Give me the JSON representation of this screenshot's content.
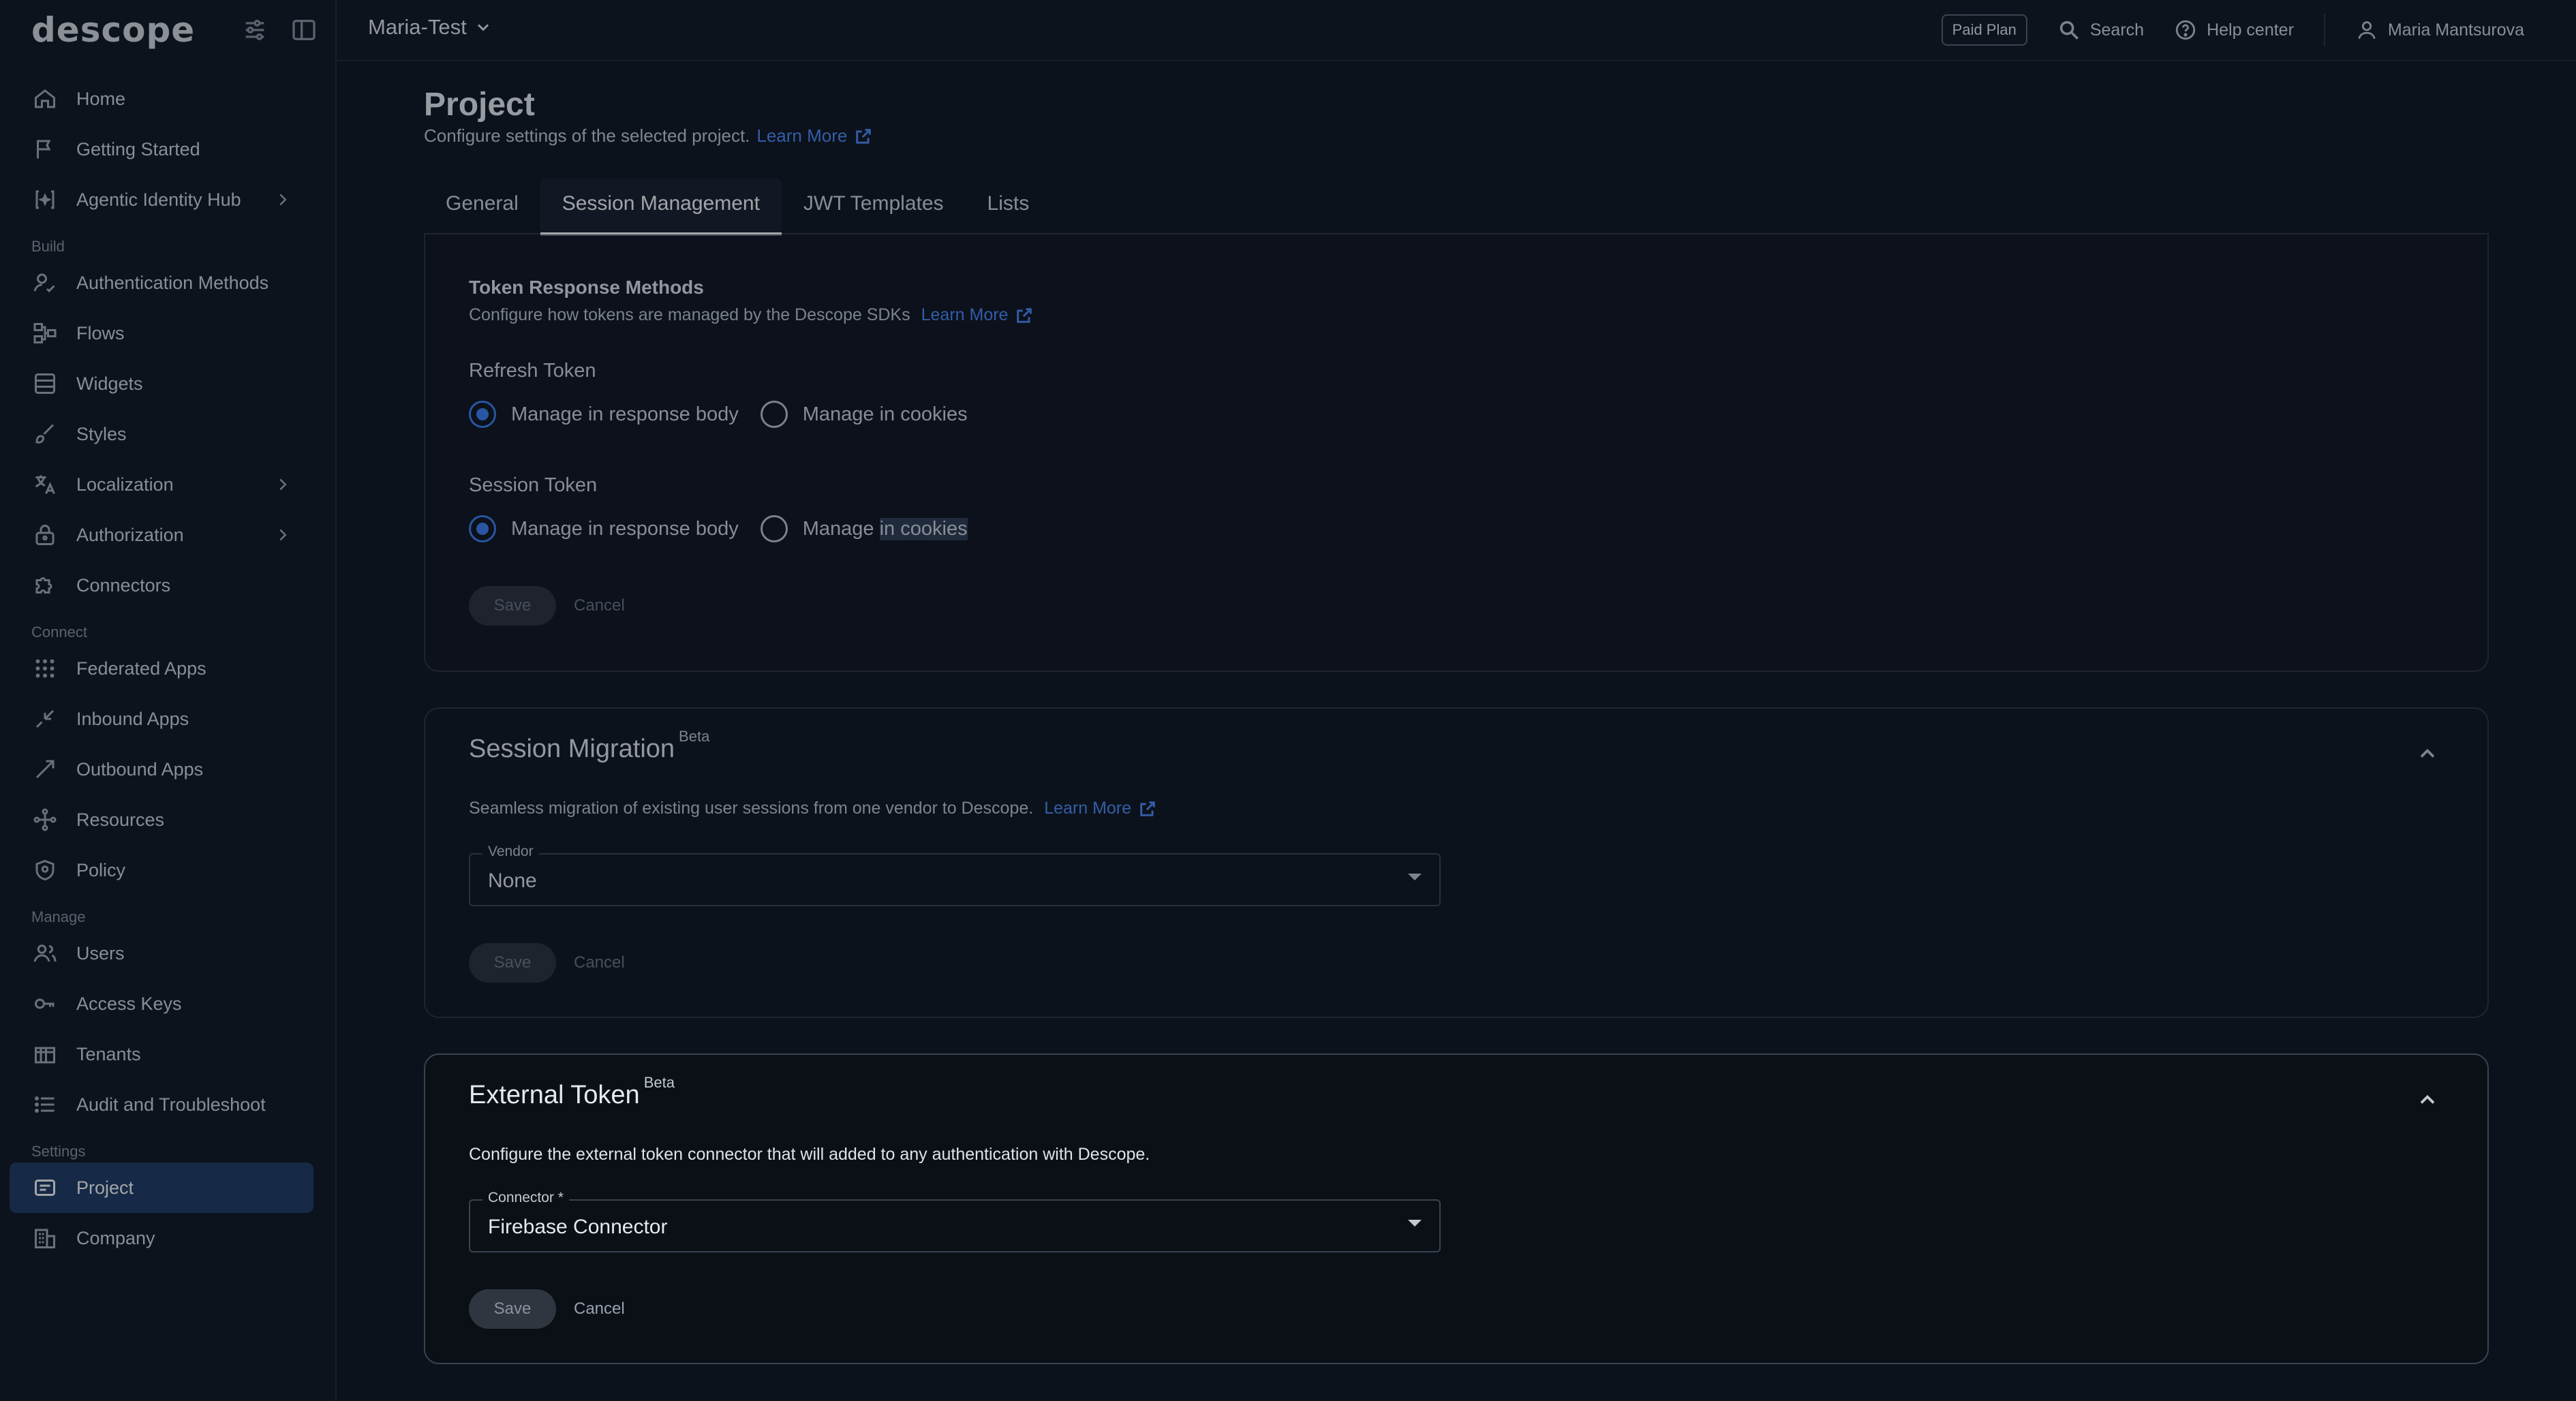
{
  "logo": "descope",
  "sidebar": {
    "top_items": [
      {
        "label": "Home",
        "icon": "home-icon"
      },
      {
        "label": "Getting Started",
        "icon": "flag-icon"
      },
      {
        "label": "Agentic Identity Hub",
        "icon": "agent-icon"
      }
    ],
    "build_label": "Build",
    "build_items": [
      {
        "label": "Authentication Methods",
        "icon": "auth-methods-icon"
      },
      {
        "label": "Flows",
        "icon": "flows-icon"
      },
      {
        "label": "Widgets",
        "icon": "widgets-icon"
      },
      {
        "label": "Styles",
        "icon": "brush-icon"
      },
      {
        "label": "Localization",
        "icon": "translate-icon"
      },
      {
        "label": "Authorization",
        "icon": "lock-icon"
      },
      {
        "label": "Connectors",
        "icon": "puzzle-icon"
      }
    ],
    "connect_label": "Connect",
    "connect_items": [
      {
        "label": "Federated Apps",
        "icon": "grid-icon"
      },
      {
        "label": "Inbound Apps",
        "icon": "inbound-icon"
      },
      {
        "label": "Outbound Apps",
        "icon": "outbound-icon"
      },
      {
        "label": "Resources",
        "icon": "resources-icon"
      },
      {
        "label": "Policy",
        "icon": "shield-icon"
      }
    ],
    "manage_label": "Manage",
    "manage_items": [
      {
        "label": "Users",
        "icon": "users-icon"
      },
      {
        "label": "Access Keys",
        "icon": "key-icon"
      },
      {
        "label": "Tenants",
        "icon": "tenants-icon"
      },
      {
        "label": "Audit and Troubleshoot",
        "icon": "list-icon"
      }
    ],
    "settings_label": "Settings",
    "settings_items": [
      {
        "label": "Project",
        "icon": "project-icon"
      },
      {
        "label": "Company",
        "icon": "company-icon"
      }
    ]
  },
  "topbar": {
    "project": "Maria-Test",
    "paid_plan": "Paid Plan",
    "search": "Search",
    "help": "Help center",
    "user": "Maria Mantsurova"
  },
  "page": {
    "title": "Project",
    "subtitle": "Configure settings of the selected project.",
    "learn_more": "Learn More",
    "tabs": [
      "General",
      "Session Management",
      "JWT Templates",
      "Lists"
    ]
  },
  "token_response": {
    "title": "Token Response Methods",
    "desc": "Configure how tokens are managed by the Descope SDKs",
    "learn_more": "Learn More",
    "refresh_label": "Refresh Token",
    "session_label": "Session Token",
    "opt_body": "Manage in response body",
    "opt_cookies_prefix": "Manage",
    "opt_cookies_suffix": "in cookies",
    "save": "Save",
    "cancel": "Cancel"
  },
  "session_migration": {
    "title": "Session Migration",
    "beta": "Beta",
    "desc": "Seamless migration of existing user sessions from one vendor to Descope.",
    "learn_more": "Learn More",
    "vendor_label": "Vendor",
    "vendor_value": "None",
    "save": "Save",
    "cancel": "Cancel"
  },
  "external_token": {
    "title": "External Token",
    "beta": "Beta",
    "desc": "Configure the external token connector that will added to any authentication with Descope.",
    "connector_label": "Connector *",
    "connector_value": "Firebase Connector",
    "save": "Save",
    "cancel": "Cancel"
  }
}
